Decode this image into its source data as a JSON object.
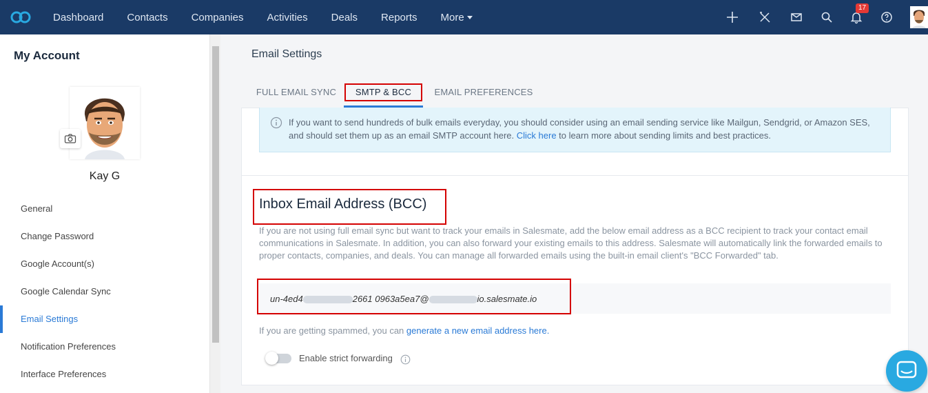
{
  "nav": {
    "items": [
      "Dashboard",
      "Contacts",
      "Companies",
      "Activities",
      "Deals",
      "Reports",
      "More"
    ],
    "notification_count": "17",
    "icons": [
      "plus-icon",
      "tools-icon",
      "mail-icon",
      "search-icon",
      "bell-icon",
      "help-icon"
    ]
  },
  "sidebar": {
    "title": "My Account",
    "user_name": "Kay G",
    "items": [
      {
        "label": "General"
      },
      {
        "label": "Change Password"
      },
      {
        "label": "Google Account(s)"
      },
      {
        "label": "Google Calendar Sync"
      },
      {
        "label": "Email Settings"
      },
      {
        "label": "Notification Preferences"
      },
      {
        "label": "Interface Preferences"
      }
    ],
    "active_item": "Email Settings"
  },
  "main": {
    "title": "Email Settings",
    "tabs": [
      {
        "label": "FULL EMAIL SYNC"
      },
      {
        "label": "SMTP & BCC"
      },
      {
        "label": "EMAIL PREFERENCES"
      }
    ],
    "active_tab": "SMTP & BCC",
    "info": {
      "text_before": "If you want to send hundreds of bulk emails everyday, you should consider using an email sending service like Mailgun, Sendgrid, or Amazon SES, and should set them up as an email SMTP account here.",
      "link": "Click here",
      "text_after": "to learn more about sending limits and best practices."
    },
    "bcc": {
      "title": "Inbox Email Address (BCC)",
      "description": "If you are not using full email sync but want to track your emails in Salesmate, add the below email address as a BCC recipient to track your contact email communications in Salesmate. In addition, you can also forward your existing emails to this address. Salesmate will automatically link the forwarded emails to proper contacts, companies, and deals. You can manage all forwarded emails using the built-in email client's \"BCC Forwarded\" tab.",
      "email_prefix": "un-4ed4",
      "email_middle": "2661 0963a5ea7@",
      "email_suffix": "io.salesmate.io",
      "spam_text": "If you are getting spammed, you can",
      "spam_link": "generate a new email address here.",
      "toggle_label": "Enable strict forwarding",
      "toggle_on": false
    }
  },
  "colors": {
    "nav_bg": "#1a3a66",
    "accent": "#2a7ad6",
    "highlight": "#d40000",
    "info_bg": "#e3f4fb",
    "chat": "#29a9e1"
  }
}
